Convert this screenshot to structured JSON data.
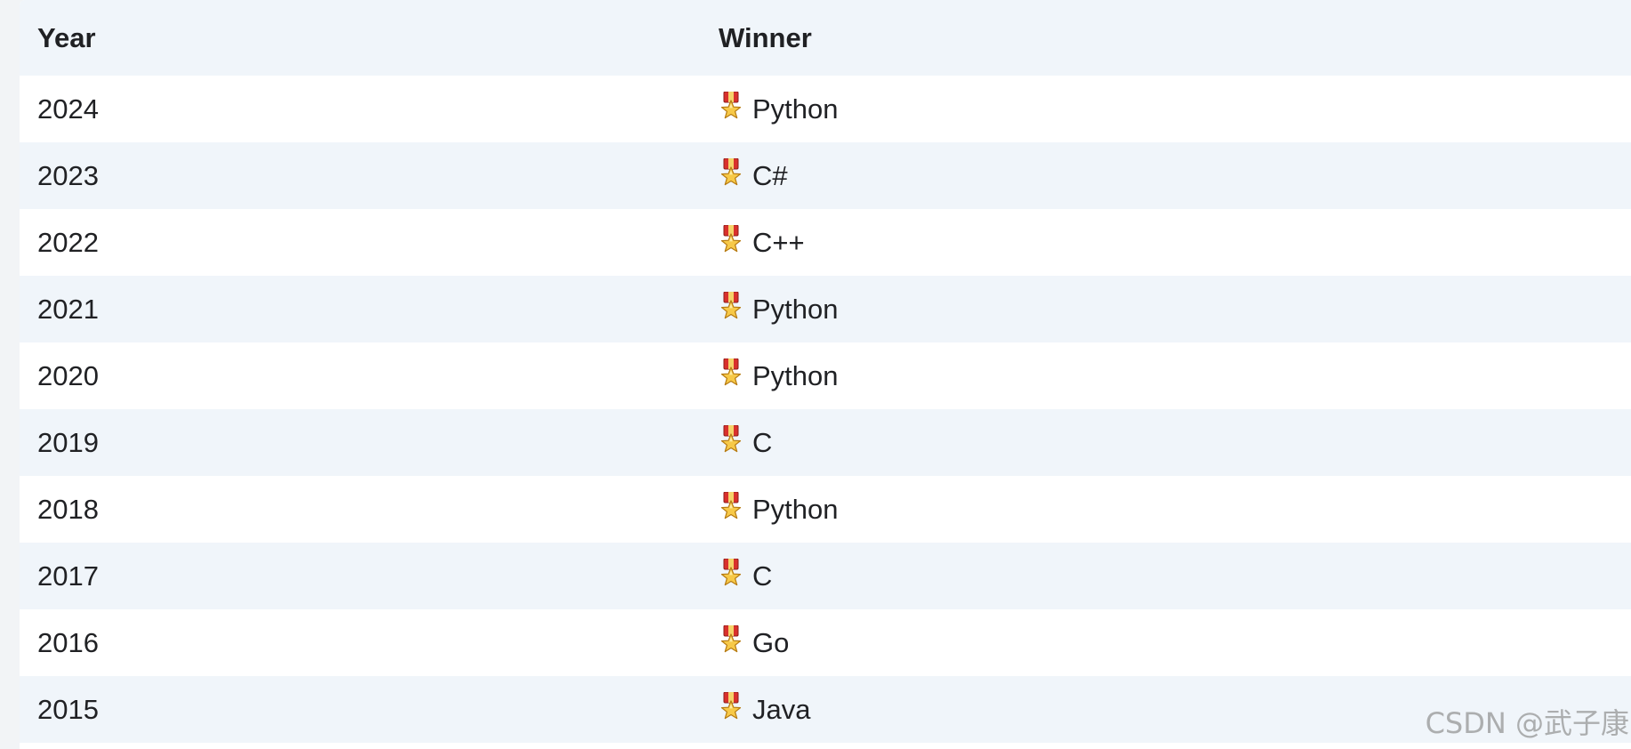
{
  "table": {
    "headers": {
      "year": "Year",
      "winner": "Winner"
    },
    "rows": [
      {
        "year": "2024",
        "winner": "Python"
      },
      {
        "year": "2023",
        "winner": "C#"
      },
      {
        "year": "2022",
        "winner": "C++"
      },
      {
        "year": "2021",
        "winner": "Python"
      },
      {
        "year": "2020",
        "winner": "Python"
      },
      {
        "year": "2019",
        "winner": "C"
      },
      {
        "year": "2018",
        "winner": "Python"
      },
      {
        "year": "2017",
        "winner": "C"
      },
      {
        "year": "2016",
        "winner": "Go"
      },
      {
        "year": "2015",
        "winner": "Java"
      }
    ]
  },
  "icons": {
    "medal": "medal-icon"
  },
  "colors": {
    "header_bg": "#f0f5fa",
    "striped_row_bg": "#f0f5fa",
    "text": "#202124"
  },
  "watermark": "CSDN @武子康"
}
